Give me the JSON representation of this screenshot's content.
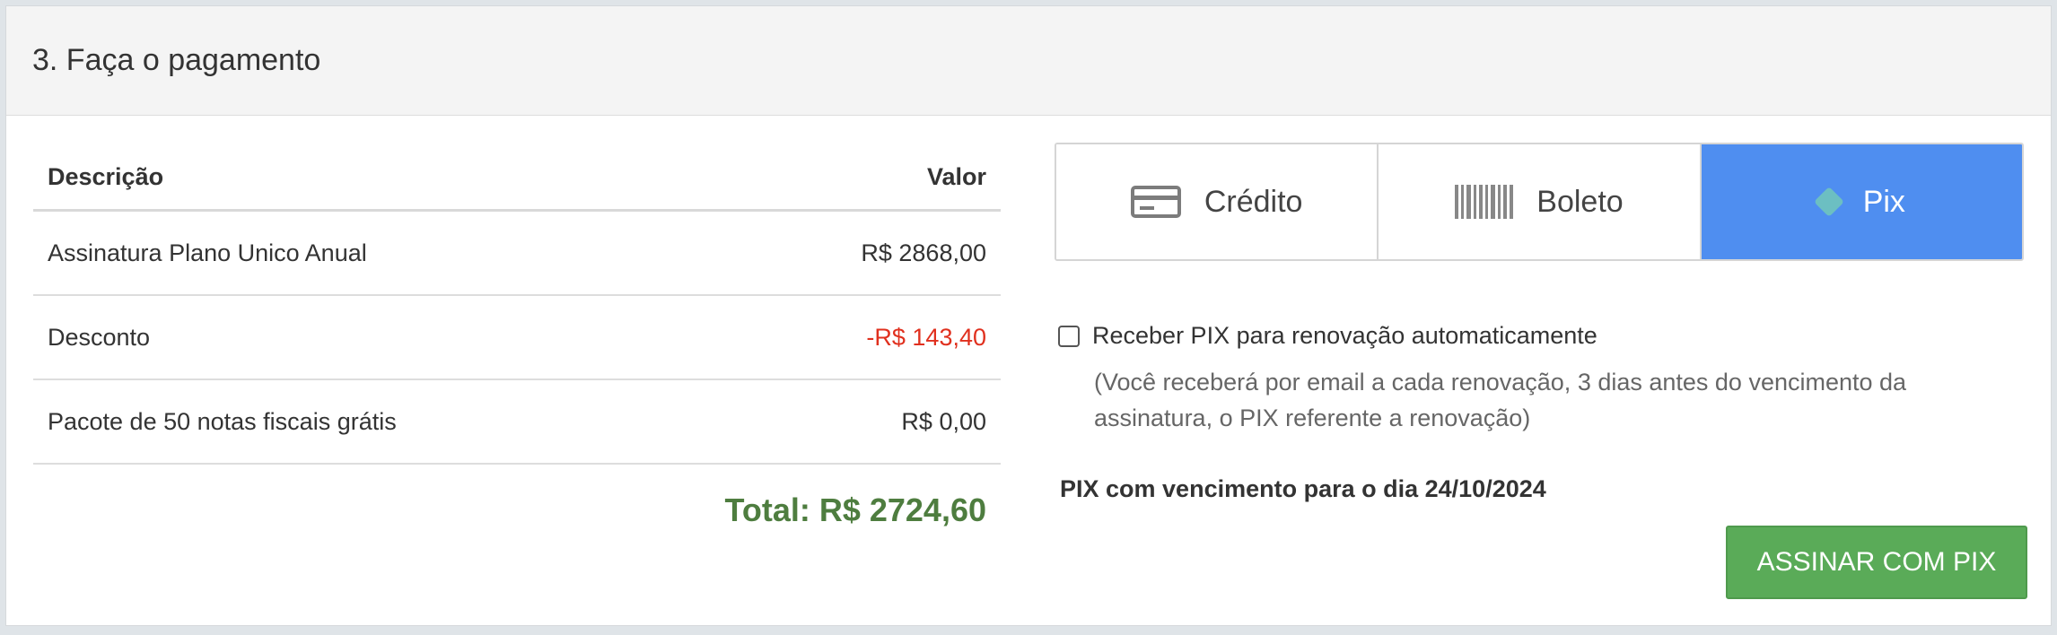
{
  "header": {
    "title": "3. Faça o pagamento"
  },
  "summary": {
    "columns": {
      "description": "Descrição",
      "value": "Valor"
    },
    "rows": [
      {
        "description": "Assinatura Plano Unico Anual",
        "value": "R$ 2868,00"
      },
      {
        "description": "Desconto",
        "value": "-R$ 143,40"
      },
      {
        "description": "Pacote de 50 notas fiscais grátis",
        "value": "R$ 0,00"
      }
    ],
    "total": "Total: R$ 2724,60"
  },
  "methods": {
    "credit": {
      "label": "Crédito",
      "icon": "credit-card-icon"
    },
    "boleto": {
      "label": "Boleto",
      "icon": "barcode-icon"
    },
    "pix": {
      "label": "Pix",
      "icon": "pix-icon"
    },
    "selected": "pix"
  },
  "renewal": {
    "checked": false,
    "label": "Receber PIX para renovação automaticamente",
    "note": "(Você receberá por email a cada renovação, 3 dias antes do vencimento da assinatura, o PIX referente a renovação)"
  },
  "due": "PIX com vencimento para o dia 24/10/2024",
  "submit_label": "ASSINAR COM PIX",
  "colors": {
    "accent": "#4f8ef0",
    "negative": "#e0301e",
    "total": "#4e7d3f",
    "submit": "#5aab58"
  }
}
